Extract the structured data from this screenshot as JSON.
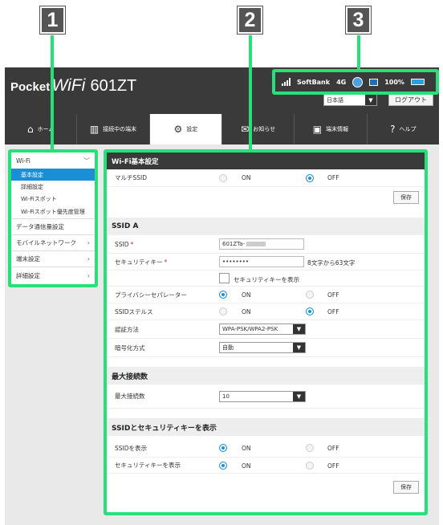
{
  "callouts": [
    "1",
    "2",
    "3"
  ],
  "brand": {
    "pocket": "Pocket",
    "wifi": "WiFi",
    "model": "601ZT"
  },
  "status": {
    "carrier": "SoftBank",
    "network": "4G",
    "battery": "100%"
  },
  "header": {
    "language": "日本語",
    "logout": "ログアウト"
  },
  "nav": [
    {
      "label": "ホーム",
      "icon": "home-icon",
      "glyph": "⌂"
    },
    {
      "label": "接続中の端末",
      "icon": "devices-icon",
      "glyph": "▥"
    },
    {
      "label": "設定",
      "icon": "gear-icon",
      "glyph": "⚙"
    },
    {
      "label": "お知らせ",
      "icon": "mail-icon",
      "glyph": "✉"
    },
    {
      "label": "端末情報",
      "icon": "info-icon",
      "glyph": "▣"
    },
    {
      "label": "ヘルプ",
      "icon": "help-icon",
      "glyph": "?"
    }
  ],
  "sidebar": {
    "wifi": "Wi-Fi",
    "sub": [
      "基本設定",
      "詳細設定",
      "Wi-Fiスポット",
      "Wi-Fiスポット優先度管理"
    ],
    "items": [
      "データ通信量設定",
      "モバイルネットワーク",
      "端末設定",
      "詳細設定"
    ]
  },
  "main": {
    "basic_title": "Wi-Fi基本設定",
    "multi_ssid": "マルチSSID",
    "on": "ON",
    "off": "OFF",
    "save": "保存",
    "ssid_a": "SSID A",
    "ssid_label": "SSID",
    "ssid_value": "601ZTa-",
    "security_key_label": "セキュリティキー",
    "security_key_value": "••••••••",
    "security_key_hint": "8文字から63文字",
    "show_key": "セキュリティキーを表示",
    "privacy_sep": "プライバシーセパレーター",
    "ssid_stealth": "SSIDステルス",
    "auth_method": "認証方法",
    "auth_value": "WPA-PSK/WPA2-PSK",
    "encryption": "暗号化方式",
    "encryption_value": "自動",
    "max_conn_title": "最大接続数",
    "max_conn_label": "最大接続数",
    "max_conn_value": "10",
    "show_title": "SSIDとセキュリティキーを表示",
    "show_ssid": "SSIDを表示",
    "show_security": "セキュリティキーを表示",
    "required_mark": "*"
  }
}
